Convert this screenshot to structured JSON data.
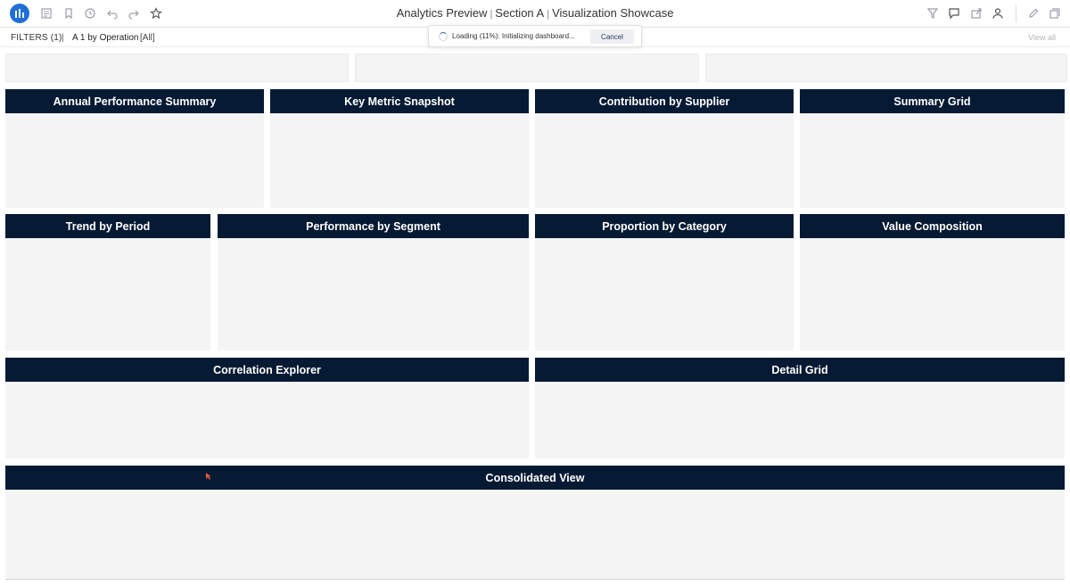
{
  "app": {
    "title_parts": [
      "Analytics Preview",
      "Section A",
      "Visualization Showcase"
    ],
    "separator": "|"
  },
  "toolbar": {
    "left_icons": [
      "logo-chart-icon",
      "notes-icon",
      "bookmark-icon",
      "history-icon",
      "undo-icon",
      "redo-icon",
      "star-icon"
    ],
    "right_icons": [
      "filter-settings-icon",
      "comment-icon",
      "share-icon",
      "user-icon",
      "edit-icon",
      "duplicate-icon"
    ]
  },
  "filterbar": {
    "label": "FILTERS (1)",
    "pipe": "|",
    "filter_name": "A 1 by Operation",
    "filter_value": "[All]",
    "view_all": "View all"
  },
  "loading": {
    "text": "Loading (11%): Initializing dashboard...",
    "progress_percent": 11,
    "cancel_label": "Cancel"
  },
  "panels": [
    {
      "id": "annual-performance-summary",
      "title": "Annual Performance Summary"
    },
    {
      "id": "key-metric-snapshot",
      "title": "Key Metric Snapshot"
    },
    {
      "id": "contribution-by-supplier",
      "title": "Contribution by Supplier"
    },
    {
      "id": "summary-grid",
      "title": "Summary Grid"
    },
    {
      "id": "trend-by-period",
      "title": "Trend by Period"
    },
    {
      "id": "performance-by-segment",
      "title": "Performance by Segment"
    },
    {
      "id": "proportion-by-category",
      "title": "Proportion by Category"
    },
    {
      "id": "value-composition",
      "title": "Value Composition"
    },
    {
      "id": "correlation-explorer",
      "title": "Correlation Explorer"
    },
    {
      "id": "detail-grid",
      "title": "Detail Grid"
    },
    {
      "id": "consolidated-view",
      "title": "Consolidated View"
    }
  ],
  "colors": {
    "panel_header": "#061a33",
    "panel_body": "#f4f4f4",
    "logo": "#1f6fd6"
  }
}
